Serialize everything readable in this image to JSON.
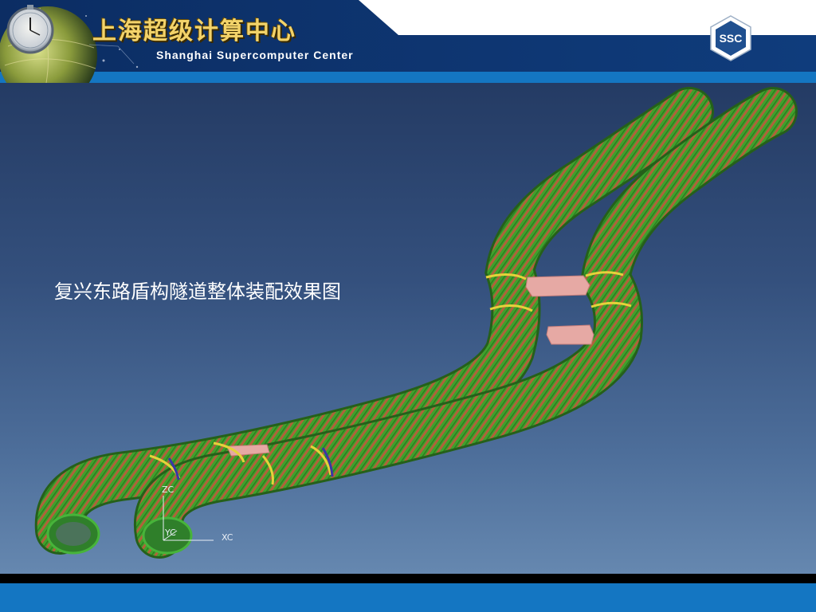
{
  "header": {
    "title_cn": "上海超级计算中心",
    "title_en": "Shanghai Supercomputer Center",
    "logo_text": "SSC"
  },
  "slide": {
    "caption": "复兴东路盾构隧道整体装配效果图"
  },
  "axes": {
    "z_label": "ZC",
    "y_label": "YC",
    "x_label": "XC"
  },
  "colors": {
    "header_navy": "#0e3a78",
    "header_accent": "#1476c2",
    "tunnel_green": "#3fa12c",
    "tunnel_orange": "#b0623a",
    "connector_pink": "#e6a9a4"
  }
}
